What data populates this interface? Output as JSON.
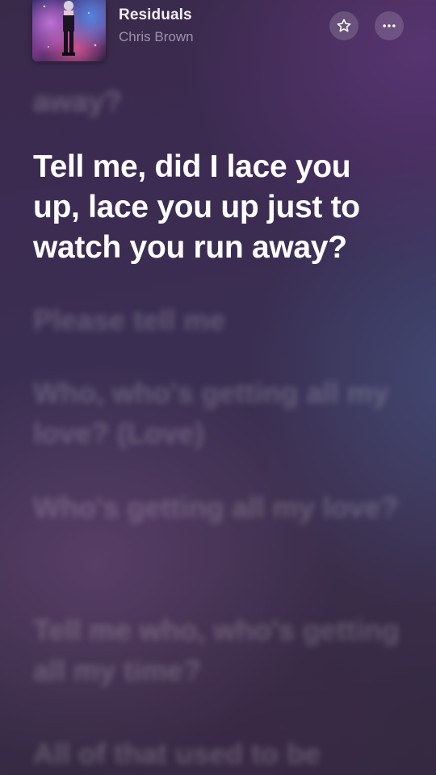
{
  "header": {
    "title": "Residuals",
    "artist": "Chris Brown",
    "favorite_icon": "star-icon",
    "more_icon": "ellipsis-icon"
  },
  "lyrics": {
    "previous": "away?",
    "current": "Tell me, did I lace you up, lace you up just to watch you run away?",
    "upcoming": [
      "Please tell me",
      "Who, who's getting all my love? (Love)",
      "Who's getting all my love?",
      "Tell me who, who's getting all my time?",
      "All of that used to be"
    ]
  },
  "colors": {
    "background_top": "#3c2b52",
    "background_bottom": "#33293f",
    "active_text": "#ffffff"
  }
}
